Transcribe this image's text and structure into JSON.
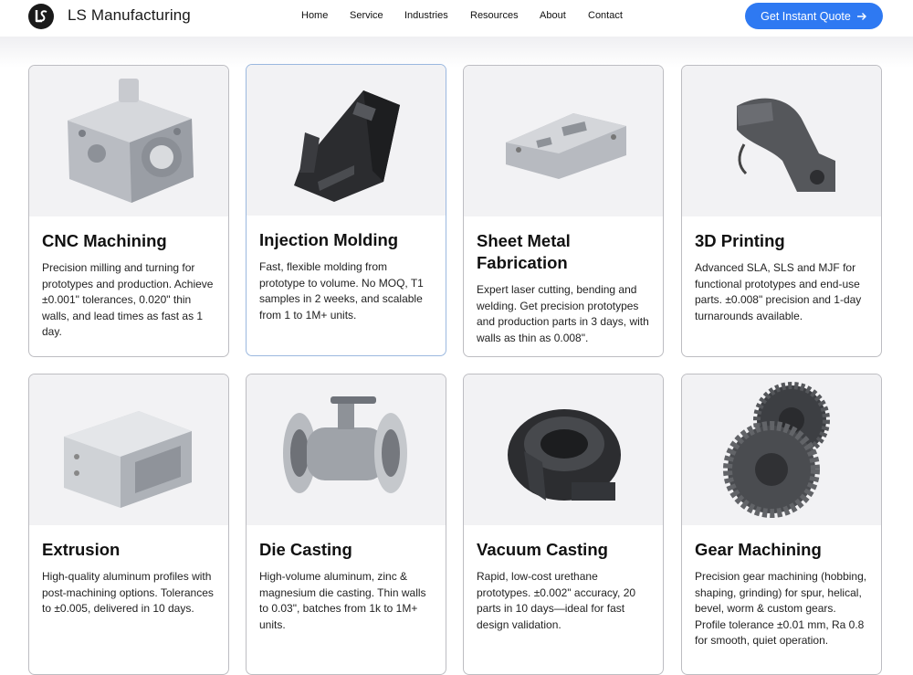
{
  "header": {
    "brand": "LS Manufacturing",
    "nav": [
      "Home",
      "Service",
      "Industries",
      "Resources",
      "About",
      "Contact"
    ],
    "cta_label": "Get Instant Quote"
  },
  "cards": [
    {
      "title": "CNC Machining",
      "desc": "Precision milling and turning for prototypes and production. Achieve ±0.001\" tolerances, 0.020\" thin walls, and lead times as fast as 1 day.",
      "icon": "cnc-part-image"
    },
    {
      "title": "Injection Molding",
      "desc": "Fast, flexible molding from prototype to volume. No MOQ, T1 samples in 2 weeks, and scalable from 1 to 1M+ units.",
      "icon": "molded-part-image"
    },
    {
      "title": "Sheet Metal Fabrication",
      "desc": "Expert laser cutting, bending and welding. Get precision prototypes and production parts in 3 days, with walls as thin as 0.008\".",
      "icon": "sheet-metal-part-image"
    },
    {
      "title": "3D Printing",
      "desc": "Advanced SLA, SLS and MJF for functional prototypes and end-use parts. ±0.008\" precision and 1-day turnarounds available.",
      "icon": "printed-part-image"
    },
    {
      "title": "Extrusion",
      "desc": "High-quality aluminum profiles with post-machining options. Tolerances to ±0.005, delivered in 10 days.",
      "icon": "extrusion-part-image"
    },
    {
      "title": "Die Casting",
      "desc": "High-volume aluminum, zinc & magnesium die casting. Thin walls to 0.03\", batches from 1k to 1M+ units.",
      "icon": "ball-valve-image"
    },
    {
      "title": "Vacuum Casting",
      "desc": "Rapid, low-cost urethane prototypes. ±0.002\" accuracy, 20 parts in 10 days—ideal for fast design validation.",
      "icon": "urethane-part-image"
    },
    {
      "title": "Gear Machining",
      "desc": "Precision gear machining (hobbing, shaping, grinding) for spur, helical, bevel, worm & custom gears. Profile tolerance ±0.01 mm, Ra 0.8 for smooth, quiet operation.",
      "icon": "gear-image"
    }
  ]
}
